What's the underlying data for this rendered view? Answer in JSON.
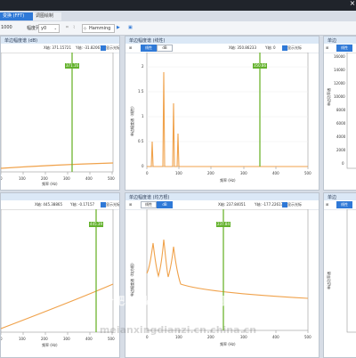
{
  "tabs": {
    "active_label": "变换 (FFT)",
    "second_label": "调图绘制"
  },
  "toolbar": {
    "left_value": "1000",
    "sort_label": "幅度列",
    "sort_value": "y0",
    "window_label": "Hamming"
  },
  "panels": {
    "p1": {
      "title": "单边幅度谱 (dB)",
      "x": "X轴: 371.15721",
      "y": "Y轴: -31.82067",
      "show_label": "显示光标",
      "cursor": "371.16",
      "x_axis": "频率 (Hz)",
      "ticks": [
        "0",
        "100",
        "200",
        "300",
        "400",
        "500"
      ]
    },
    "p2": {
      "title": "单边幅度谱 (线性)",
      "mode1": "线性",
      "mode2": "dB",
      "x": "X轴: 350.86233",
      "y": "Y轴: 0",
      "show_label": "显示光标",
      "cursor": "350.86",
      "x_axis": "频率 (Hz)",
      "y_axis": "单边幅度谱（线性）",
      "yticks": [
        "2",
        "1.5",
        "1",
        "0.5",
        "0"
      ],
      "ticks": [
        "0",
        "100",
        "200",
        "300",
        "400",
        "500"
      ]
    },
    "p3": {
      "title": "单边",
      "mode1": "线性",
      "y_axis": "单边功率谱",
      "yticks": [
        "16000",
        "14000",
        "12000",
        "10000",
        "8000",
        "6000",
        "4000",
        "2000",
        "0"
      ]
    },
    "p4": {
      "title": "",
      "x": "X轴: 445.38865",
      "y": "Y轴: -0.17157",
      "show_label": "显示光标",
      "cursor": "445.39",
      "x_axis": "频率 (Hz)",
      "ticks": [
        "0",
        "100",
        "200",
        "300",
        "400",
        "500"
      ]
    },
    "p5": {
      "title": "单边幅度谱 (均方根)",
      "mode1": "线性",
      "mode2": "dB",
      "x": "X轴: 237.84051",
      "y": "Y轴: -177.22617",
      "show_label": "显示光标",
      "cursor": "237.84",
      "x_axis": "频率 (Hz)",
      "y_axis": "单边幅度谱（均方根）",
      "ticks": [
        "0",
        "100",
        "200",
        "300",
        "400",
        "500"
      ]
    },
    "p6": {
      "title": "单边",
      "mode1": "线性",
      "y_axis": "单边功率谱"
    }
  },
  "watermark": {
    "line1": "合肥美昂兴电子技术有限公司",
    "line2": "meianxingdianzi.cn.china.cn"
  },
  "colors": {
    "accent": "#2f79d7",
    "trace": "#f0a24b",
    "cursor": "#6eb52f"
  }
}
